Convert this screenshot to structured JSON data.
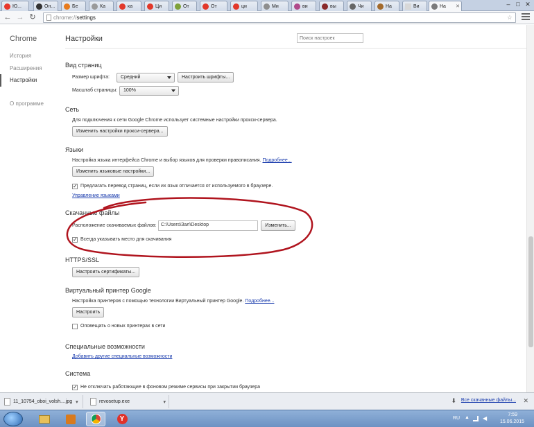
{
  "tabs": [
    {
      "label": "Ю..."
    },
    {
      "label": "Он..."
    },
    {
      "label": "Бе"
    },
    {
      "label": "Ка"
    },
    {
      "label": "ка"
    },
    {
      "label": "Ци"
    },
    {
      "label": "От"
    },
    {
      "label": "От"
    },
    {
      "label": "ци"
    },
    {
      "label": "Ми"
    },
    {
      "label": "ви"
    },
    {
      "label": "вы"
    },
    {
      "label": "Чи"
    },
    {
      "label": "На"
    },
    {
      "label": "Ви"
    },
    {
      "label": "На"
    }
  ],
  "address": {
    "scheme": "chrome://",
    "path": "settings"
  },
  "sidebar": {
    "brand": "Chrome",
    "items": [
      {
        "label": "История"
      },
      {
        "label": "Расширения"
      },
      {
        "label": "Настройки"
      },
      {
        "label": "О программе"
      }
    ]
  },
  "main": {
    "title": "Настройки",
    "search_placeholder": "Поиск настроек",
    "page_view": {
      "heading": "Вид страниц",
      "font_size_label": "Размер шрифта:",
      "font_size_value": "Средний",
      "font_settings_button": "Настроить шрифты...",
      "zoom_label": "Масштаб страницы:",
      "zoom_value": "100%"
    },
    "network": {
      "heading": "Сеть",
      "description": "Для подключения к сети Google Chrome использует системные настройки прокси-сервера.",
      "proxy_button": "Изменить настройки прокси-сервера..."
    },
    "languages": {
      "heading": "Языки",
      "description": "Настройка языка интерфейса Chrome и выбор языков для проверки правописания.",
      "more_link": "Подробнее...",
      "lang_button": "Изменить языковые настройки...",
      "translate_checkbox": "Предлагать перевод страниц, если их язык отличается от используемого в браузере.",
      "manage_link": "Управление языками"
    },
    "downloads": {
      "heading": "Скачанные файлы",
      "location_label": "Расположение скачиваемых файлов:",
      "location_value": "C:\\Users\\Зал\\Desktop",
      "change_button": "Изменить...",
      "ask_checkbox": "Всегда указывать место для скачивания"
    },
    "https": {
      "heading": "HTTPS/SSL",
      "cert_button": "Настроить сертификаты..."
    },
    "cloud_print": {
      "heading": "Виртуальный принтер Google",
      "description": "Настройка принтеров с помощью технологии Виртуальный принтер Google.",
      "more_link": "Подробнее...",
      "setup_button": "Настроить",
      "notify_checkbox": "Оповещать о новых принтерах в сети"
    },
    "accessibility": {
      "heading": "Специальные возможности",
      "add_link": "Добавить другие специальные возможности"
    },
    "system": {
      "heading": "Система",
      "background_checkbox": "Не отключать работающие в фоновом режиме сервисы при закрытии браузера"
    }
  },
  "downloads_bar": {
    "items": [
      {
        "file": "11_10754_oboi_volsh....jpg"
      },
      {
        "file": "revosetup.exe"
      }
    ],
    "show_all": "Все скачанные файлы..."
  },
  "taskbar": {
    "lang": "RU",
    "time": "7:59",
    "date": "15.06.2015"
  },
  "colors": {
    "accent_link": "#1a3cad",
    "annotation_ellipse": "#b0141e"
  }
}
